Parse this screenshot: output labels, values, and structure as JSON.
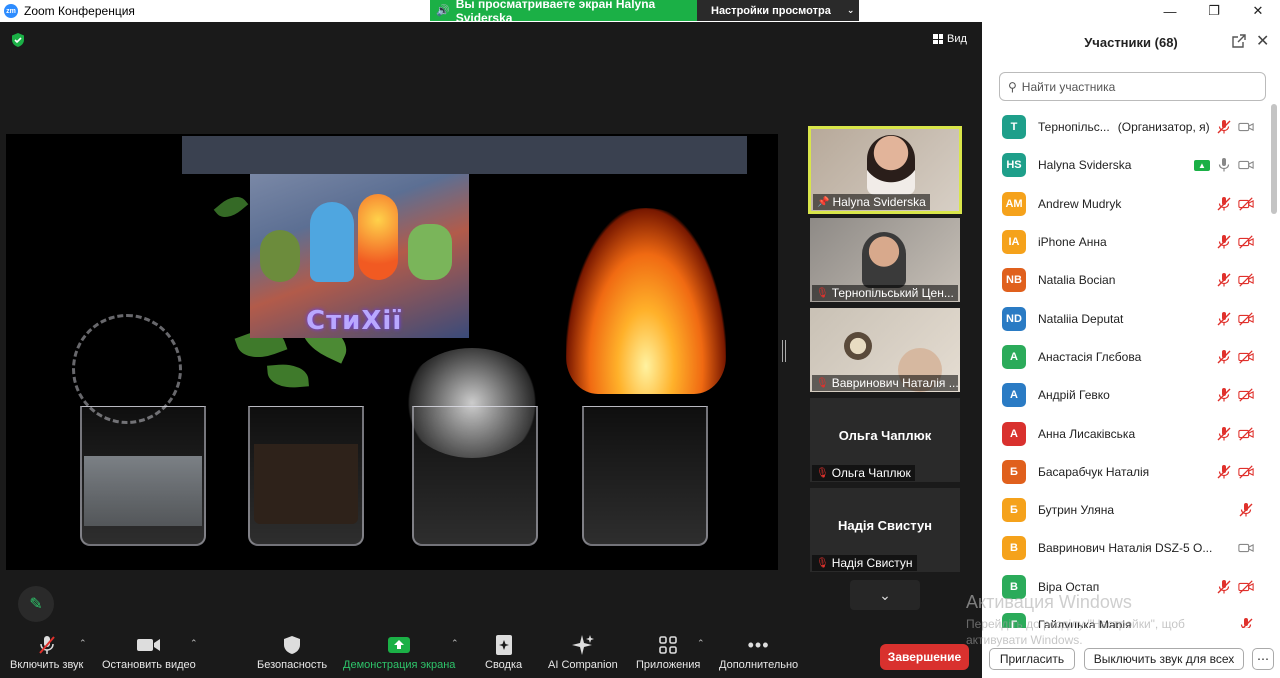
{
  "window": {
    "title": "Zoom Конференция",
    "logo_text": "zm"
  },
  "share_banner": {
    "viewing_text": "Вы просматриваете экран Halyna Sviderska",
    "view_options": "Настройки просмотра"
  },
  "meeting": {
    "view_label": "Вид",
    "poster_title": "СтиХії"
  },
  "gallery": [
    {
      "name": "Halyna Sviderska",
      "muted": false,
      "has_video": true,
      "pinned": true
    },
    {
      "name": "Тернопільський Цен...",
      "muted": true,
      "has_video": true
    },
    {
      "name": "Вавринович Наталія ...",
      "muted": true,
      "has_video": true
    },
    {
      "name": "Ольга Чаплюк",
      "tile_name": "Ольга Чаплюк",
      "muted": true,
      "has_video": false
    },
    {
      "name": "Надія Свистун",
      "tile_name": "Надія Свистун",
      "muted": true,
      "has_video": false
    }
  ],
  "toolbar": {
    "unmute": "Включить звук",
    "stop_video": "Остановить видео",
    "security": "Безопасность",
    "share_screen": "Демонстрация экрана",
    "summary": "Сводка",
    "ai_companion": "AI Companion",
    "apps": "Приложения",
    "more": "Дополнительно",
    "end": "Завершение"
  },
  "participants": {
    "title": "Участники (68)",
    "search_placeholder": "Найти участника",
    "list": [
      {
        "initials": "T",
        "name": "Тернопільс...",
        "role": "(Организатор, я)",
        "color": "#1e9f8a",
        "mic": "off",
        "cam": "on"
      },
      {
        "initials": "HS",
        "name": "Halyna Sviderska",
        "color": "#1e9f8a",
        "sharing": true,
        "mic": "on",
        "cam": "on"
      },
      {
        "initials": "AM",
        "name": "Andrew Mudryk",
        "color": "#f5a21b",
        "mic": "off",
        "cam": "off"
      },
      {
        "initials": "IA",
        "name": "iPhone Анна",
        "color": "#f5a21b",
        "mic": "off",
        "cam": "off"
      },
      {
        "initials": "NB",
        "name": "Natalia Bocian",
        "color": "#e0601d",
        "mic": "off",
        "cam": "off"
      },
      {
        "initials": "ND",
        "name": "Nataliia Deputat",
        "color": "#2a7bc4",
        "mic": "off",
        "cam": "off"
      },
      {
        "initials": "А",
        "name": "Анастасія Глєбова",
        "color": "#2bab5a",
        "mic": "off",
        "cam": "off"
      },
      {
        "initials": "А",
        "name": "Андрій Гевко",
        "color": "#2a7bc4",
        "mic": "off",
        "cam": "off"
      },
      {
        "initials": "А",
        "name": "Анна Лисаківська",
        "color": "#d9312e",
        "mic": "off",
        "cam": "off"
      },
      {
        "initials": "Б",
        "name": "Басарабчук Наталія",
        "color": "#e0601d",
        "mic": "off",
        "cam": "off"
      },
      {
        "initials": "Б",
        "name": "Бутрин Уляна",
        "color": "#f5a21b",
        "mic": "off",
        "cam": "none"
      },
      {
        "initials": "В",
        "name": "Вавринович Наталія DSZ-5 О...",
        "color": "#f5a21b",
        "mic": "none",
        "cam": "on"
      },
      {
        "initials": "В",
        "name": "Віра Остап",
        "color": "#2bab5a",
        "mic": "off",
        "cam": "off"
      },
      {
        "initials": "Г",
        "name": "Гайдуцька Марія",
        "color": "#2bab5a",
        "mic": "off",
        "cam": "none"
      }
    ],
    "invite": "Пригласить",
    "mute_all": "Выключить звук для всех"
  },
  "watermark": {
    "title": "Активация Windows",
    "subtitle": "Перейдіть до розділу \"Настройки\", щоб активувати Windows."
  }
}
